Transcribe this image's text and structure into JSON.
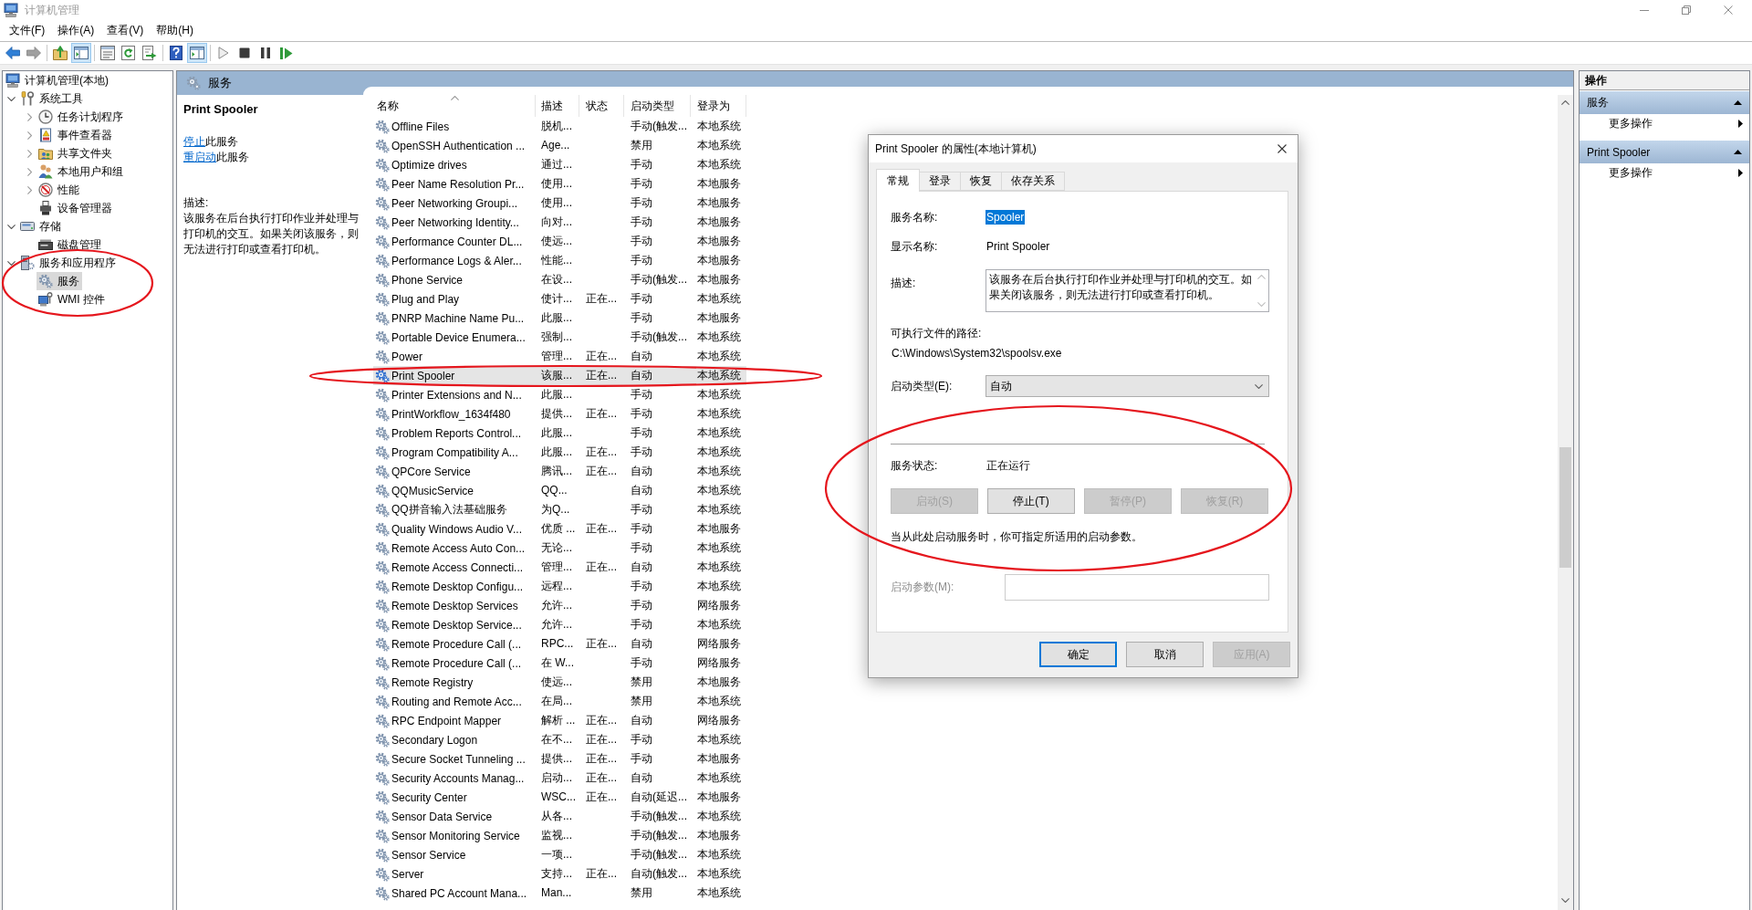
{
  "window": {
    "title": "计算机管理"
  },
  "menu": [
    "文件(F)",
    "操作(A)",
    "查看(V)",
    "帮助(H)"
  ],
  "toolbar": [
    [
      {
        "kind": "back",
        "on": false,
        "disabled": false
      },
      {
        "kind": "forward",
        "on": false,
        "disabled": true
      }
    ],
    [
      {
        "kind": "up",
        "on": false,
        "disabled": false
      },
      {
        "kind": "console-tree",
        "on": true,
        "disabled": false
      }
    ],
    [
      {
        "kind": "properties",
        "on": false,
        "disabled": false
      },
      {
        "kind": "refresh",
        "on": false,
        "disabled": false
      },
      {
        "kind": "export",
        "on": false,
        "disabled": false
      }
    ],
    [
      {
        "kind": "help",
        "on": false,
        "disabled": false
      },
      {
        "kind": "action-pane",
        "on": true,
        "disabled": false
      }
    ],
    [
      {
        "kind": "play",
        "on": false,
        "disabled": true
      },
      {
        "kind": "stop",
        "on": false,
        "disabled": false
      },
      {
        "kind": "pause",
        "on": false,
        "disabled": false
      },
      {
        "kind": "resume",
        "on": false,
        "disabled": false
      }
    ]
  ],
  "tree": [
    {
      "label": "计算机管理(本地)",
      "kind": "computer",
      "selected": false,
      "children": [
        {
          "label": "系统工具",
          "kind": "tools",
          "expanded": true,
          "selected": false,
          "children": [
            {
              "label": "任务计划程序",
              "kind": "clock",
              "expanded": false,
              "selected": false
            },
            {
              "label": "事件查看器",
              "kind": "event-log",
              "expanded": false,
              "selected": false
            },
            {
              "label": "共享文件夹",
              "kind": "shared-folder",
              "expanded": false,
              "selected": false
            },
            {
              "label": "本地用户和组",
              "kind": "users",
              "expanded": false,
              "selected": false
            },
            {
              "label": "性能",
              "kind": "performance",
              "expanded": false,
              "selected": false
            },
            {
              "label": "设备管理器",
              "kind": "device",
              "selected": false
            }
          ]
        },
        {
          "label": "存储",
          "kind": "storage",
          "expanded": true,
          "selected": false,
          "children": [
            {
              "label": "磁盘管理",
              "kind": "disk",
              "selected": false
            }
          ]
        },
        {
          "label": "服务和应用程序",
          "kind": "services-apps",
          "expanded": true,
          "selected": false,
          "children": [
            {
              "label": "服务",
              "kind": "services",
              "selected": true
            },
            {
              "label": "WMI 控件",
              "kind": "wmi",
              "selected": false
            }
          ]
        }
      ]
    }
  ],
  "services_panel": {
    "title": "服务",
    "detail": {
      "title": "Print Spooler",
      "actions": [
        {
          "link": "停止",
          "text": "此服务"
        },
        {
          "link": "重启动",
          "text": "此服务"
        }
      ],
      "description_label": "描述:",
      "description": "该服务在后台执行打印作业并处理与打印机的交互。如果关闭该服务，则无法进行打印或查看打印机。"
    },
    "table": {
      "columns": [
        {
          "label": "名称",
          "sorted": true
        },
        {
          "label": "描述",
          "sorted": false
        },
        {
          "label": "状态",
          "sorted": false
        },
        {
          "label": "启动类型",
          "sorted": false
        },
        {
          "label": "登录为",
          "sorted": false
        }
      ],
      "rows": [
        {
          "name": "Offline Files",
          "description": "脱机...",
          "startup_type": "手动(触发...",
          "log_on_as": "本地系统",
          "selected": false
        },
        {
          "name": "OpenSSH Authentication ...",
          "description": "Age...",
          "startup_type": "禁用",
          "log_on_as": "本地系统",
          "selected": false
        },
        {
          "name": "Optimize drives",
          "description": "通过...",
          "startup_type": "手动",
          "log_on_as": "本地系统",
          "selected": false
        },
        {
          "name": "Peer Name Resolution Pr...",
          "description": "使用...",
          "startup_type": "手动",
          "log_on_as": "本地服务",
          "selected": false
        },
        {
          "name": "Peer Networking Groupi...",
          "description": "使用...",
          "startup_type": "手动",
          "log_on_as": "本地服务",
          "selected": false
        },
        {
          "name": "Peer Networking Identity...",
          "description": "向对...",
          "startup_type": "手动",
          "log_on_as": "本地服务",
          "selected": false
        },
        {
          "name": "Performance Counter DL...",
          "description": "使远...",
          "startup_type": "手动",
          "log_on_as": "本地服务",
          "selected": false
        },
        {
          "name": "Performance Logs & Aler...",
          "description": "性能...",
          "startup_type": "手动",
          "log_on_as": "本地服务",
          "selected": false
        },
        {
          "name": "Phone Service",
          "description": "在设...",
          "startup_type": "手动(触发...",
          "log_on_as": "本地服务",
          "selected": false
        },
        {
          "name": "Plug and Play",
          "description": "使计...",
          "status": "正在...",
          "startup_type": "手动",
          "log_on_as": "本地系统",
          "selected": false
        },
        {
          "name": "PNRP Machine Name Pu...",
          "description": "此服...",
          "startup_type": "手动",
          "log_on_as": "本地服务",
          "selected": false
        },
        {
          "name": "Portable Device Enumera...",
          "description": "强制...",
          "startup_type": "手动(触发...",
          "log_on_as": "本地系统",
          "selected": false
        },
        {
          "name": "Power",
          "description": "管理...",
          "status": "正在...",
          "startup_type": "自动",
          "log_on_as": "本地系统",
          "selected": false
        },
        {
          "name": "Print Spooler",
          "description": "该服...",
          "status": "正在...",
          "startup_type": "自动",
          "log_on_as": "本地系统",
          "selected": true
        },
        {
          "name": "Printer Extensions and N...",
          "description": "此服...",
          "startup_type": "手动",
          "log_on_as": "本地系统",
          "selected": false
        },
        {
          "name": "PrintWorkflow_1634f480",
          "description": "提供...",
          "status": "正在...",
          "startup_type": "手动",
          "log_on_as": "本地系统",
          "selected": false
        },
        {
          "name": "Problem Reports Control...",
          "description": "此服...",
          "startup_type": "手动",
          "log_on_as": "本地系统",
          "selected": false
        },
        {
          "name": "Program Compatibility A...",
          "description": "此服...",
          "status": "正在...",
          "startup_type": "手动",
          "log_on_as": "本地系统",
          "selected": false
        },
        {
          "name": "QPCore Service",
          "description": "腾讯...",
          "status": "正在...",
          "startup_type": "自动",
          "log_on_as": "本地系统",
          "selected": false
        },
        {
          "name": "QQMusicService",
          "description": "QQ...",
          "startup_type": "自动",
          "log_on_as": "本地系统",
          "selected": false
        },
        {
          "name": "QQ拼音输入法基础服务",
          "description": "为Q...",
          "startup_type": "手动",
          "log_on_as": "本地系统",
          "selected": false
        },
        {
          "name": "Quality Windows Audio V...",
          "description": "优质 ...",
          "status": "正在...",
          "startup_type": "手动",
          "log_on_as": "本地服务",
          "selected": false
        },
        {
          "name": "Remote Access Auto Con...",
          "description": "无论...",
          "startup_type": "手动",
          "log_on_as": "本地系统",
          "selected": false
        },
        {
          "name": "Remote Access Connecti...",
          "description": "管理...",
          "status": "正在...",
          "startup_type": "自动",
          "log_on_as": "本地系统",
          "selected": false
        },
        {
          "name": "Remote Desktop Configu...",
          "description": "远程...",
          "startup_type": "手动",
          "log_on_as": "本地系统",
          "selected": false
        },
        {
          "name": "Remote Desktop Services",
          "description": "允许...",
          "startup_type": "手动",
          "log_on_as": "网络服务",
          "selected": false
        },
        {
          "name": "Remote Desktop Service...",
          "description": "允许...",
          "startup_type": "手动",
          "log_on_as": "本地系统",
          "selected": false
        },
        {
          "name": "Remote Procedure Call (...",
          "description": "RPC...",
          "status": "正在...",
          "startup_type": "自动",
          "log_on_as": "网络服务",
          "selected": false
        },
        {
          "name": "Remote Procedure Call (...",
          "description": "在 W...",
          "startup_type": "手动",
          "log_on_as": "网络服务",
          "selected": false
        },
        {
          "name": "Remote Registry",
          "description": "使远...",
          "startup_type": "禁用",
          "log_on_as": "本地服务",
          "selected": false
        },
        {
          "name": "Routing and Remote Acc...",
          "description": "在局...",
          "startup_type": "禁用",
          "log_on_as": "本地系统",
          "selected": false
        },
        {
          "name": "RPC Endpoint Mapper",
          "description": "解析 ...",
          "status": "正在...",
          "startup_type": "自动",
          "log_on_as": "网络服务",
          "selected": false
        },
        {
          "name": "Secondary Logon",
          "description": "在不...",
          "status": "正在...",
          "startup_type": "手动",
          "log_on_as": "本地系统",
          "selected": false
        },
        {
          "name": "Secure Socket Tunneling ...",
          "description": "提供...",
          "status": "正在...",
          "startup_type": "手动",
          "log_on_as": "本地服务",
          "selected": false
        },
        {
          "name": "Security Accounts Manag...",
          "description": "启动...",
          "status": "正在...",
          "startup_type": "自动",
          "log_on_as": "本地系统",
          "selected": false
        },
        {
          "name": "Security Center",
          "description": "WSC...",
          "status": "正在...",
          "startup_type": "自动(延迟...",
          "log_on_as": "本地服务",
          "selected": false
        },
        {
          "name": "Sensor Data Service",
          "description": "从各...",
          "startup_type": "手动(触发...",
          "log_on_as": "本地系统",
          "selected": false
        },
        {
          "name": "Sensor Monitoring Service",
          "description": "监视...",
          "startup_type": "手动(触发...",
          "log_on_as": "本地服务",
          "selected": false
        },
        {
          "name": "Sensor Service",
          "description": "一项...",
          "startup_type": "手动(触发...",
          "log_on_as": "本地系统",
          "selected": false
        },
        {
          "name": "Server",
          "description": "支持...",
          "status": "正在...",
          "startup_type": "自动(触发...",
          "log_on_as": "本地系统",
          "selected": false
        },
        {
          "name": "Shared PC Account Mana...",
          "description": "Man...",
          "startup_type": "禁用",
          "log_on_as": "本地系统",
          "selected": false
        }
      ]
    }
  },
  "properties_dialog": {
    "title": "Print Spooler 的属性(本地计算机)",
    "tabs": [
      {
        "label": "常规",
        "selected": true
      },
      {
        "label": "登录",
        "selected": false
      },
      {
        "label": "恢复",
        "selected": false
      },
      {
        "label": "依存关系",
        "selected": false
      }
    ],
    "service_name": {
      "label": "服务名称:",
      "value": "Spooler",
      "selected": true
    },
    "display_name": {
      "label": "显示名称:",
      "value": "Print Spooler"
    },
    "description": {
      "label": "描述:",
      "value": "该服务在后台执行打印作业并处理与打印机的交互。如果关闭该服务，则无法进行打印或查看打印机。"
    },
    "executable_path": {
      "label": "可执行文件的路径:",
      "value": "C:\\Windows\\System32\\spoolsv.exe"
    },
    "startup_type": {
      "label": "启动类型(E):",
      "value": "自动"
    },
    "service_status": {
      "label": "服务状态:",
      "value": "正在运行"
    },
    "control_buttons": [
      {
        "label": "启动(S)",
        "disabled": true
      },
      {
        "label": "停止(T)",
        "disabled": false
      },
      {
        "label": "暂停(P)",
        "disabled": true
      },
      {
        "label": "恢复(R)",
        "disabled": true
      }
    ],
    "hint": "当从此处启动服务时，你可指定所适用的启动参数。",
    "start_parameters": {
      "label": "启动参数(M):",
      "disabled": true
    },
    "buttons": [
      {
        "label": "确定",
        "default": true,
        "disabled": false
      },
      {
        "label": "取消",
        "default": false,
        "disabled": false
      },
      {
        "label": "应用(A)",
        "default": false,
        "disabled": true
      }
    ]
  },
  "actions_pane": {
    "title": "操作",
    "sections": [
      {
        "title": "服务",
        "expanded": true,
        "items": [
          "更多操作"
        ]
      },
      {
        "title": "Print Spooler",
        "expanded": true,
        "items": [
          "更多操作"
        ]
      }
    ]
  }
}
